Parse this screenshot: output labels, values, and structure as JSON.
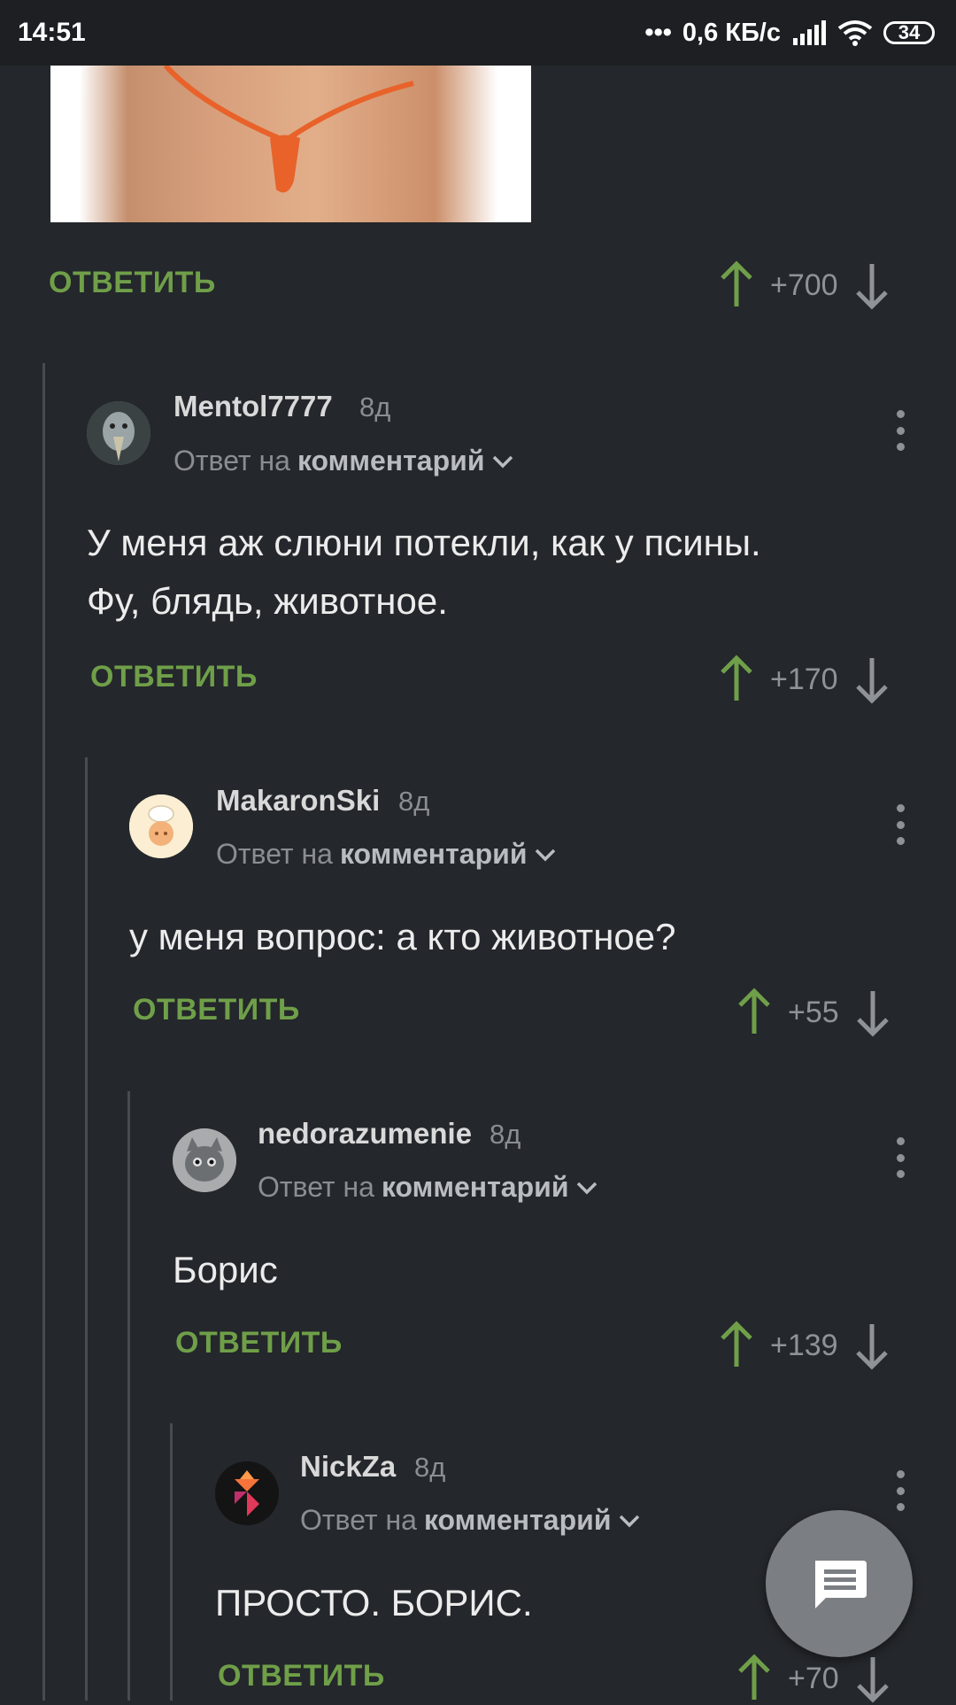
{
  "status_bar": {
    "time": "14:51",
    "network_speed": "0,6 КБ/с",
    "battery": "34"
  },
  "labels": {
    "reply": "ОТВЕТИТЬ",
    "reply_to_prefix": "Ответ на",
    "reply_to_target": "комментарий"
  },
  "top_comment": {
    "score": "+700"
  },
  "comments": [
    {
      "username": "Mentol7777",
      "age": "8д",
      "text_line1": "У меня аж слюни потекли, как у псины.",
      "text_line2": "Фу, блядь, животное.",
      "score": "+170"
    },
    {
      "username": "MakaronSki",
      "age": "8д",
      "text_line1": "у меня вопрос: а кто животное?",
      "score": "+55"
    },
    {
      "username": "nedorazumenie",
      "age": "8д",
      "text_line1": "Борис",
      "score": "+139"
    },
    {
      "username": "NickZa",
      "age": "8д",
      "text_line1": "ПРОСТО. БОРИС.",
      "score": "+70"
    }
  ],
  "colors": {
    "background": "#24272b",
    "reply_green": "#6f9f49",
    "upvote_green": "#6f9f49",
    "downvote_gray": "#8f9297"
  },
  "icons": [
    "signal-icon",
    "wifi-icon",
    "arrow-up-icon",
    "arrow-down-icon",
    "chevron-down-icon",
    "more-vert-icon",
    "comment-icon"
  ]
}
